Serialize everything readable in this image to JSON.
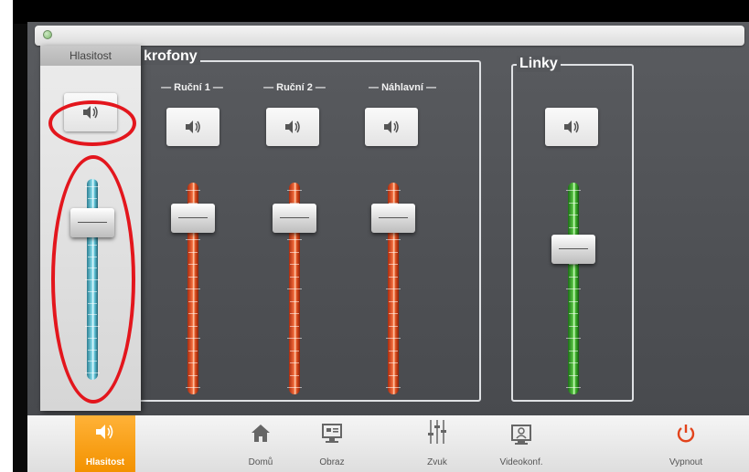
{
  "app": {
    "title_bar": ""
  },
  "volume_panel": {
    "title": "Hlasitost",
    "mute_icon": "speaker-icon",
    "level": 0.75
  },
  "mics_group": {
    "title": "krofony",
    "channels": [
      {
        "label": "Ruční 1",
        "level": 0.77
      },
      {
        "label": "Ruční 2",
        "level": 0.77
      },
      {
        "label": "Náhlavní",
        "level": 0.77
      }
    ]
  },
  "lines_group": {
    "title": "Linky",
    "channels": [
      {
        "label": "",
        "level": 0.6
      }
    ]
  },
  "colors": {
    "accent": "#f39200",
    "mic_slider": "#e0501f",
    "line_slider": "#3fb22c",
    "volume_slider": "#5ec4d8",
    "annotation": "#e3161d"
  },
  "nav": {
    "items": [
      {
        "label": "Hlasitost",
        "icon": "speaker-icon",
        "active": true
      },
      {
        "label": "Domů",
        "icon": "home-icon"
      },
      {
        "label": "Obraz",
        "icon": "monitor-icon"
      },
      {
        "label": "Zvuk",
        "icon": "mixer-icon"
      },
      {
        "label": "Videokonf.",
        "icon": "videoconference-icon"
      },
      {
        "label": "Vypnout",
        "icon": "power-icon"
      }
    ]
  }
}
